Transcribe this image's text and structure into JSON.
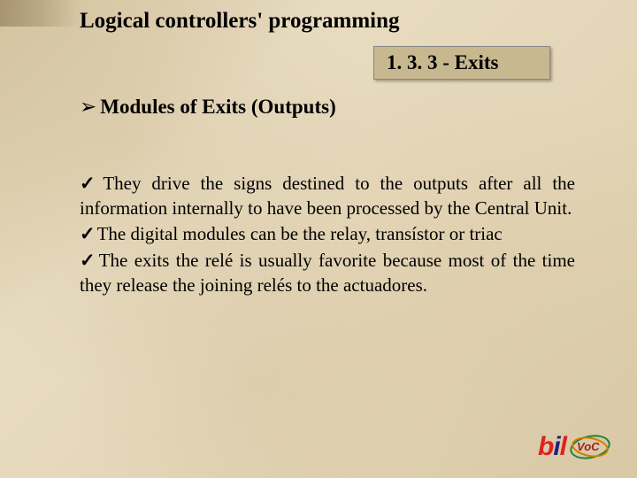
{
  "title": "Logical controllers' programming",
  "section_badge": "1. 3. 3 - Exits",
  "subheader": "Modules of Exits (Outputs)",
  "paragraphs": [
    "They drive the signs destined to the outputs after all the information internally to have been processed by the Central Unit.",
    "The digital modules can be the relay, transístor or triac",
    "The exits the relé is usually favorite because most of the time they release the joining relés to the actuadores."
  ],
  "logo": {
    "text": "bil",
    "badge": "VoC"
  }
}
